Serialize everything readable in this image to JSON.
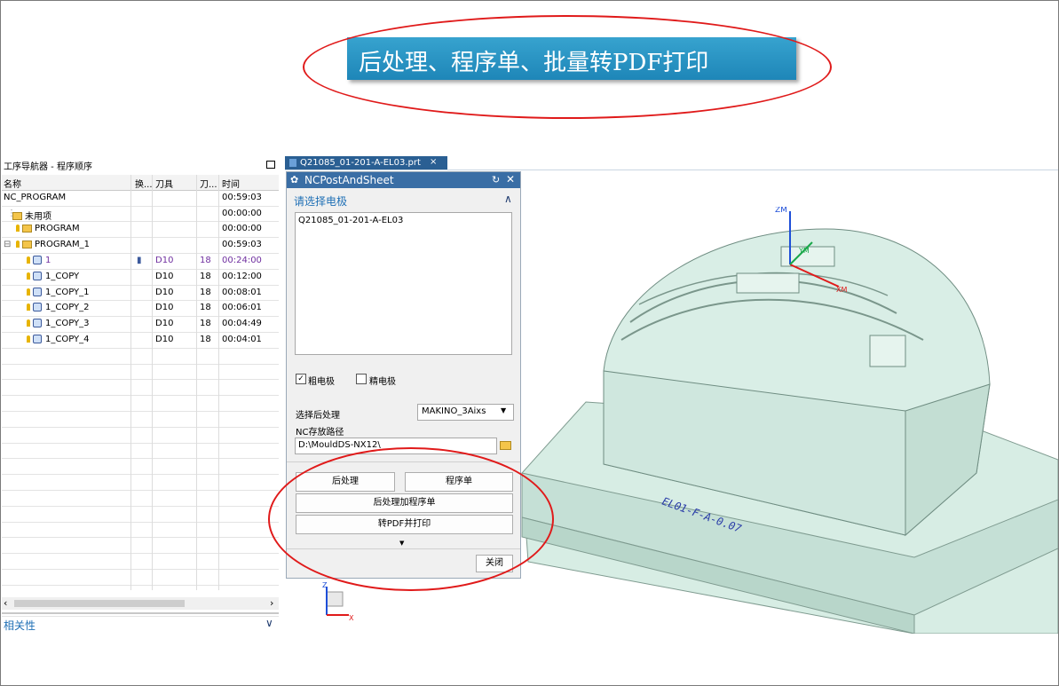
{
  "banner": {
    "title": "后处理、程序单、批量转PDF打印"
  },
  "navigator": {
    "title": "工序导航器 - 程序顺序",
    "columns": [
      "名称",
      "换...",
      "刀具",
      "刀...",
      "时间"
    ],
    "rows": [
      {
        "name": "NC_PROGRAM",
        "tool": "",
        "tool_no": "",
        "time": "00:59:03"
      },
      {
        "name": "未用项",
        "tool": "",
        "tool_no": "",
        "time": "00:00:00"
      },
      {
        "name": "PROGRAM",
        "tool": "",
        "tool_no": "",
        "time": "00:00:00"
      },
      {
        "name": "PROGRAM_1",
        "tool": "",
        "tool_no": "",
        "time": "00:59:03"
      },
      {
        "name": "1",
        "tool": "D10",
        "tool_no": "18",
        "time": "00:24:00"
      },
      {
        "name": "1_COPY",
        "tool": "D10",
        "tool_no": "18",
        "time": "00:12:00"
      },
      {
        "name": "1_COPY_1",
        "tool": "D10",
        "tool_no": "18",
        "time": "00:08:01"
      },
      {
        "name": "1_COPY_2",
        "tool": "D10",
        "tool_no": "18",
        "time": "00:06:01"
      },
      {
        "name": "1_COPY_3",
        "tool": "D10",
        "tool_no": "18",
        "time": "00:04:49"
      },
      {
        "name": "1_COPY_4",
        "tool": "D10",
        "tool_no": "18",
        "time": "00:04:01"
      }
    ],
    "dependency_label": "相关性"
  },
  "file_tab": {
    "label": "Q21085_01-201-A-EL03.prt",
    "close": "×"
  },
  "dialog": {
    "title": "NCPostAndSheet",
    "section_label": "请选择电极",
    "electrode_list": [
      "Q21085_01-201-A-EL03"
    ],
    "rough_label": "粗电极",
    "rough_checked": true,
    "finish_label": "精电极",
    "finish_checked": false,
    "post_label": "选择后处理",
    "post_value": "MAKINO_3Aixs",
    "nc_path_label": "NC存放路径",
    "nc_path_value": "D:\\MouldDS-NX12\\",
    "btn_post": "后处理",
    "btn_sheet": "程序单",
    "btn_post_sheet": "后处理加程序单",
    "btn_pdf": "转PDF并打印",
    "btn_close": "关闭"
  },
  "viewport": {
    "engraving": "EL01-F-A-0.07",
    "axis_zm": "ZM",
    "axis_ym": "YM",
    "axis_xm": "XM",
    "triad_z": "Z",
    "triad_x": "X"
  },
  "colors": {
    "accent": "#1e6fb5",
    "annotation": "#e01a1a",
    "model": "#cfe9df",
    "banner": "#2b95c4"
  }
}
